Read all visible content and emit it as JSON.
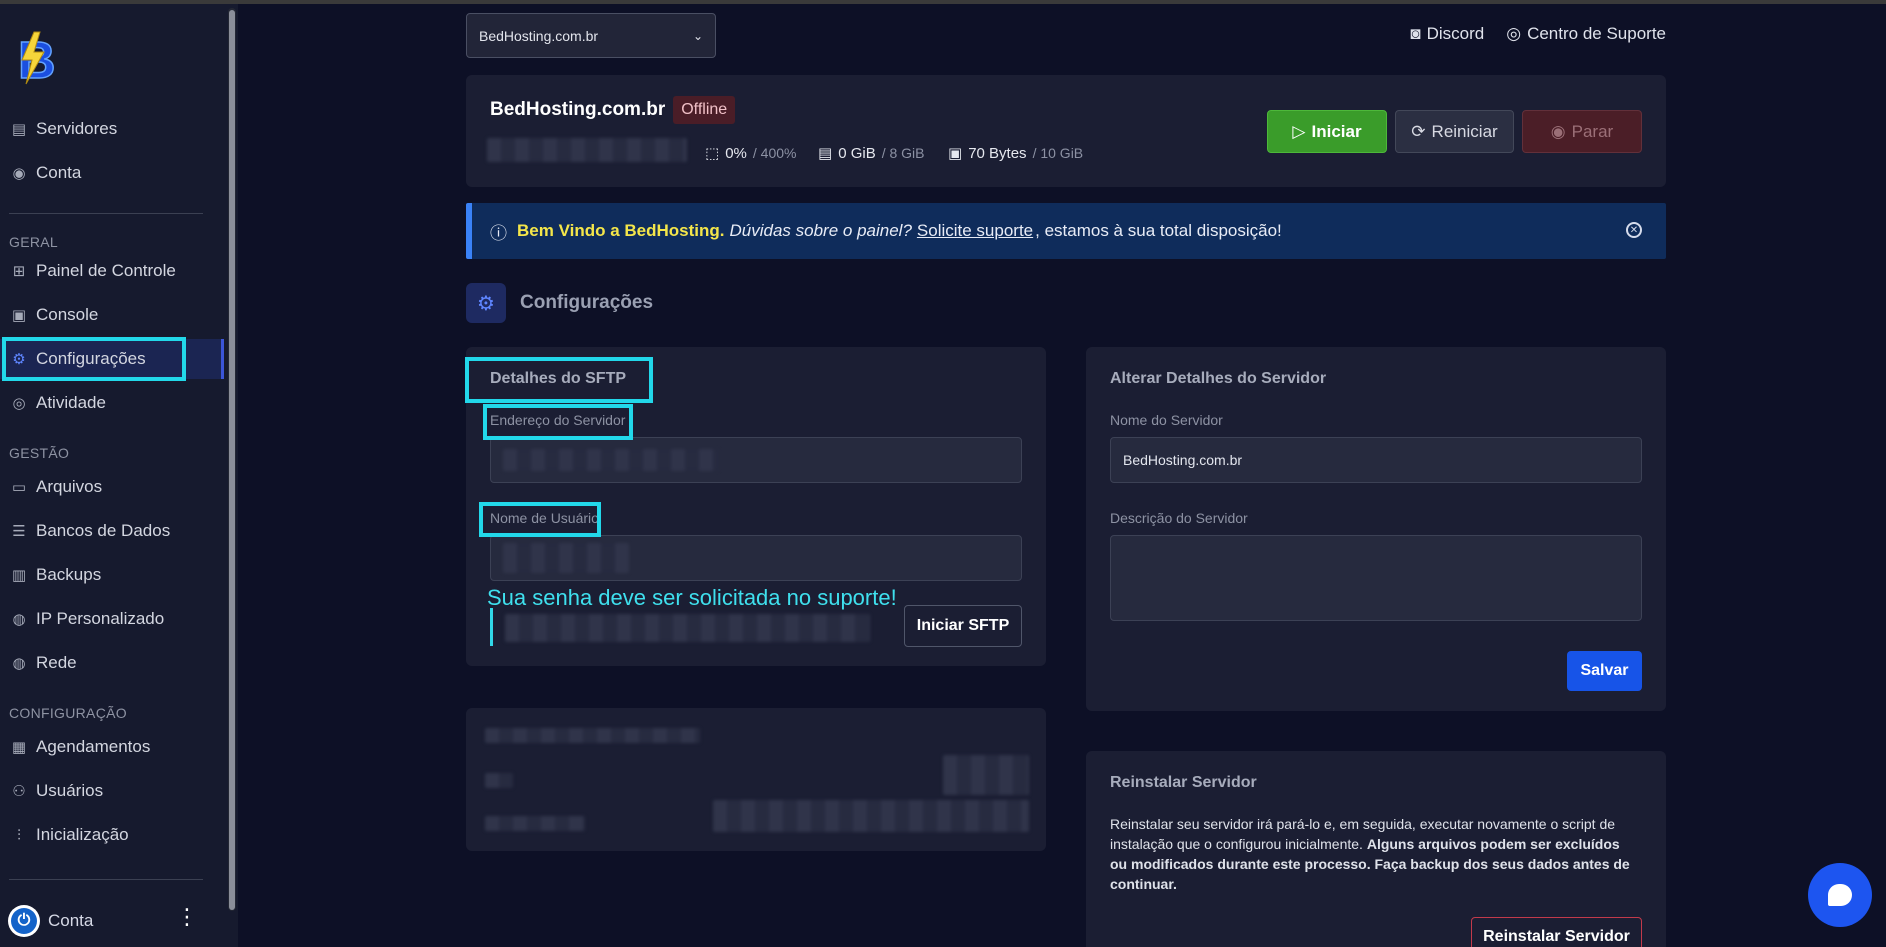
{
  "sidebar": {
    "items": {
      "servers": "Servidores",
      "account": "Conta",
      "control_panel": "Painel de Controle",
      "console": "Console",
      "settings": "Configurações",
      "activity": "Atividade",
      "files": "Arquivos",
      "databases": "Bancos de Dados",
      "backups": "Backups",
      "custom_ip": "IP Personalizado",
      "network": "Rede",
      "schedules": "Agendamentos",
      "users": "Usuários",
      "startup": "Inicialização"
    },
    "sections": {
      "general": "GERAL",
      "management": "GESTÃO",
      "configuration": "CONFIGURAÇÃO"
    },
    "bottom_account": "Conta",
    "kebab": "⋮"
  },
  "header": {
    "server_select": "BedHosting.com.br",
    "discord": "Discord",
    "support_center": "Centro de Suporte"
  },
  "server": {
    "name": "BedHosting.com.br",
    "status": "Offline",
    "cpu": "0%",
    "cpu_limit": "/ 400%",
    "memory": "0 GiB",
    "memory_limit": "/ 8 GiB",
    "disk": "70 Bytes",
    "disk_limit": "/ 10 GiB",
    "buttons": {
      "start": "Iniciar",
      "restart": "Reiniciar",
      "stop": "Parar"
    }
  },
  "alert": {
    "bold": "Bem Vindo a BedHosting.",
    "italic": "Dúvidas sobre o painel?",
    "link": "Solicite suporte",
    "rest": ", estamos à sua total disposição!"
  },
  "page": {
    "title": "Configurações"
  },
  "sftp": {
    "title": "Detalhes do SFTP",
    "address_label": "Endereço do Servidor",
    "username_label": "Nome de Usuário",
    "note": "Sua senha deve ser solicitada no suporte!",
    "button": "Iniciar SFTP"
  },
  "details": {
    "title": "Alterar Detalhes do Servidor",
    "name_label": "Nome do Servidor",
    "name_value": "BedHosting.com.br",
    "description_label": "Descrição do Servidor",
    "save": "Salvar"
  },
  "reinstall": {
    "title": "Reinstalar Servidor",
    "text": "Reinstalar seu servidor irá pará-lo e, em seguida, executar novamente o script de instalação que o configurou inicialmente. ",
    "bold": "Alguns arquivos podem ser excluídos ou modificados durante este processo. Faça backup dos seus dados antes de continuar.",
    "button": "Reinstalar Servidor"
  },
  "colors": {
    "accent": "#1754e8",
    "highlight": "#22d8ea",
    "start": "#3a9c2a"
  }
}
